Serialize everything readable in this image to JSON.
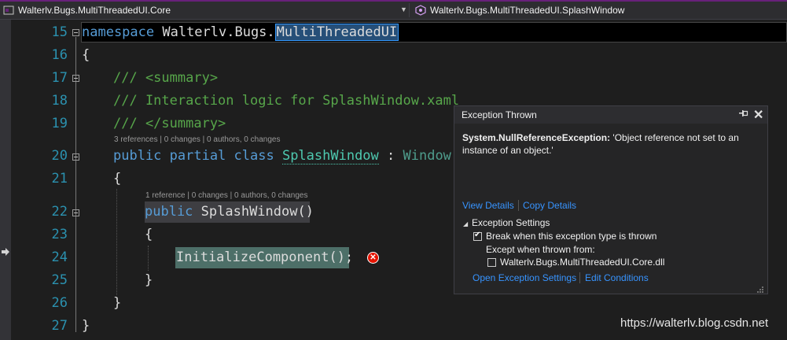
{
  "topbar": {
    "left_dropdown": "Walterlv.Bugs.MultiThreadedUI.Core",
    "right_dropdown": "Walterlv.Bugs.MultiThreadedUI.SplashWindow"
  },
  "line_numbers": [
    "15",
    "16",
    "17",
    "18",
    "19",
    "20",
    "21",
    "22",
    "23",
    "24",
    "25",
    "26",
    "27"
  ],
  "code": {
    "l15_kw": "namespace",
    "l15_ns_a": " Walterlv.Bugs.",
    "l15_ns_sel": "MultiThreadedUI",
    "l16": "{",
    "l17": "/// <summary>",
    "l18": "/// Interaction logic for SplashWindow.xaml",
    "l19": "/// </summary>",
    "lens_class": "3 references | 0 changes | 0 authors, 0 changes",
    "l20_kw": "public partial class",
    "l20_type": "SplashWindow",
    "l20_colon": " : ",
    "l20_base": "Window",
    "l21": "{",
    "lens_ctor": "1 reference | 0 changes | 0 authors, 0 changes",
    "l22_kw": "public",
    "l22_rest": " SplashWindow()",
    "l23": "{",
    "l24": "InitializeComponent();",
    "l25": "}",
    "l26": "}",
    "l27": "}"
  },
  "exception_popup": {
    "title": "Exception Thrown",
    "pin_icon": "pin-icon",
    "close_icon": "close-icon",
    "exception_type": "System.NullReferenceException:",
    "message": " 'Object reference not set to an instance of an object.'",
    "view_details": "View Details",
    "copy_details": "Copy Details",
    "settings_header": "Exception Settings",
    "break_when": "Break when this exception type is thrown",
    "break_checked": true,
    "except_when": "Except when thrown from:",
    "except_module": "Walterlv.Bugs.MultiThreadedUI.Core.dll",
    "except_checked": false,
    "open_settings": "Open Exception Settings",
    "edit_conditions": "Edit Conditions"
  },
  "watermark": "https://walterlv.blog.csdn.net",
  "colors": {
    "accent": "#68217a",
    "keyword": "#569cd6",
    "comment": "#57a64a",
    "type": "#4ec9b0",
    "line_number": "#2b91af",
    "error": "#e51400",
    "link": "#3794ff"
  }
}
